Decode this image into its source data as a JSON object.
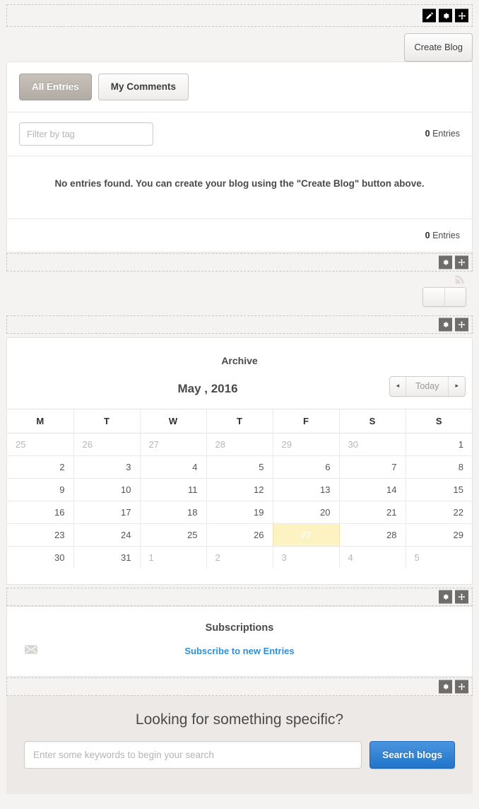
{
  "toolbar": {
    "edit_icon": "pencil-icon",
    "settings_icon": "gear-icon",
    "move_icon": "move-icon"
  },
  "actions": {
    "create_blog_label": "Create Blog"
  },
  "tabs": [
    {
      "label": "All Entries",
      "active": true
    },
    {
      "label": "My Comments",
      "active": false
    }
  ],
  "filter": {
    "placeholder": "Filter by tag",
    "value": "",
    "count_number": "0",
    "count_label": " Entries"
  },
  "entries": {
    "empty_message": "No entries found. You can create your blog using the \"Create Blog\" button above.",
    "footer_count_number": "0",
    "footer_count_label": " Entries"
  },
  "rss": {
    "icon": "rss-icon"
  },
  "archive": {
    "title": "Archive",
    "month_label": "May , 2016",
    "nav": {
      "prev": "◂",
      "today": "Today",
      "next": "▸"
    },
    "weekday_headers": [
      "M",
      "T",
      "W",
      "T",
      "F",
      "S",
      "S"
    ],
    "weeks": [
      [
        {
          "d": "25",
          "type": "other"
        },
        {
          "d": "26",
          "type": "other"
        },
        {
          "d": "27",
          "type": "other"
        },
        {
          "d": "28",
          "type": "other"
        },
        {
          "d": "29",
          "type": "other"
        },
        {
          "d": "30",
          "type": "other"
        },
        {
          "d": "1",
          "type": "current"
        }
      ],
      [
        {
          "d": "2",
          "type": "current"
        },
        {
          "d": "3",
          "type": "current"
        },
        {
          "d": "4",
          "type": "current"
        },
        {
          "d": "5",
          "type": "current"
        },
        {
          "d": "6",
          "type": "current"
        },
        {
          "d": "7",
          "type": "current"
        },
        {
          "d": "8",
          "type": "current"
        }
      ],
      [
        {
          "d": "9",
          "type": "current"
        },
        {
          "d": "10",
          "type": "current"
        },
        {
          "d": "11",
          "type": "current"
        },
        {
          "d": "12",
          "type": "current"
        },
        {
          "d": "13",
          "type": "current"
        },
        {
          "d": "14",
          "type": "current"
        },
        {
          "d": "15",
          "type": "current"
        }
      ],
      [
        {
          "d": "16",
          "type": "current"
        },
        {
          "d": "17",
          "type": "current"
        },
        {
          "d": "18",
          "type": "current"
        },
        {
          "d": "19",
          "type": "current"
        },
        {
          "d": "20",
          "type": "current"
        },
        {
          "d": "21",
          "type": "current"
        },
        {
          "d": "22",
          "type": "current"
        }
      ],
      [
        {
          "d": "23",
          "type": "current"
        },
        {
          "d": "24",
          "type": "current"
        },
        {
          "d": "25",
          "type": "current"
        },
        {
          "d": "26",
          "type": "current"
        },
        {
          "d": "27",
          "type": "today"
        },
        {
          "d": "28",
          "type": "current"
        },
        {
          "d": "29",
          "type": "current"
        }
      ],
      [
        {
          "d": "30",
          "type": "current"
        },
        {
          "d": "31",
          "type": "current"
        },
        {
          "d": "1",
          "type": "other"
        },
        {
          "d": "2",
          "type": "other"
        },
        {
          "d": "3",
          "type": "other"
        },
        {
          "d": "4",
          "type": "other"
        },
        {
          "d": "5",
          "type": "other"
        }
      ]
    ]
  },
  "subscriptions": {
    "title": "Subscriptions",
    "link_label": "Subscribe to new Entries",
    "mail_icon": "envelope-icon"
  },
  "search": {
    "heading": "Looking for something specific?",
    "placeholder": "Enter some keywords to begin your search",
    "value": "",
    "button_label": "Search blogs"
  },
  "colors": {
    "page_bg": "#f4f3f2",
    "panel_bg": "#ffffff",
    "search_panel_bg": "#ece9e7",
    "today_highlight": "#fdf2c1",
    "link_blue": "#2f8fd6",
    "primary_button": "#1f74c9",
    "active_tab": "#b2aba3"
  }
}
